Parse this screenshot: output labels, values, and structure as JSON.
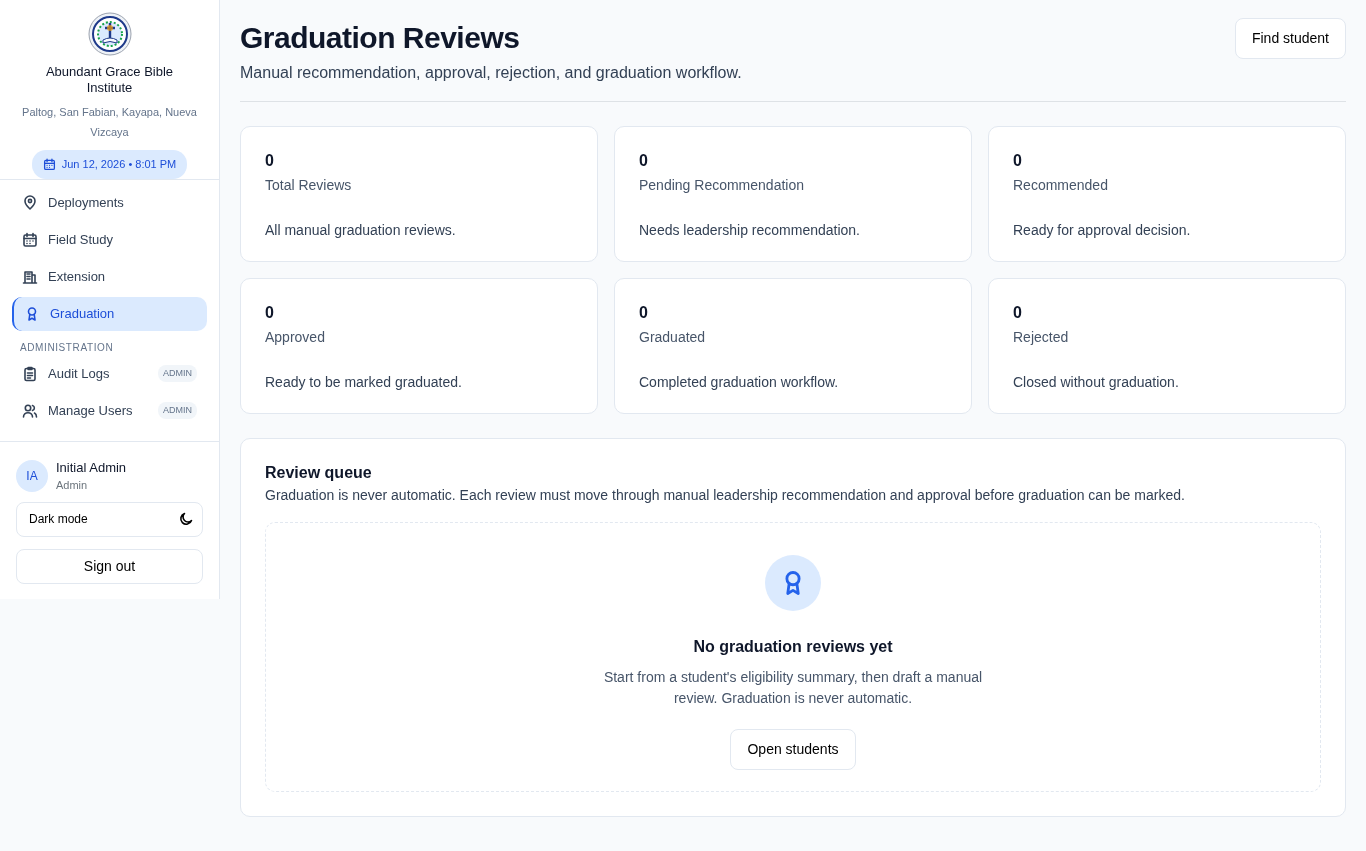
{
  "sidebar": {
    "org_name": "Abundant Grace Bible Institute",
    "org_address": "Paltog, San Fabian, Kayapa, Nueva Vizcaya",
    "datetime": "Jun 12, 2026 • 8:01 PM",
    "nav": [
      {
        "kind": "item",
        "label": "Deployments",
        "selected": false
      },
      {
        "kind": "item",
        "label": "Field Study",
        "selected": false
      },
      {
        "kind": "item",
        "label": "Extension",
        "selected": false
      },
      {
        "kind": "item",
        "label": "Graduation",
        "selected": true
      },
      {
        "kind": "heading",
        "label": "ADMINISTRATION"
      },
      {
        "kind": "item",
        "label": "Audit Logs",
        "badge": "ADMIN",
        "selected": false
      },
      {
        "kind": "item",
        "label": "Manage Users",
        "badge": "ADMIN",
        "selected": false
      }
    ],
    "user": {
      "initials": "IA",
      "name": "Initial Admin",
      "role": "Admin"
    },
    "dark_mode": {
      "label": "Dark mode",
      "on": false
    },
    "sign_out": "Sign out"
  },
  "page": {
    "title": "Graduation Reviews",
    "subtitle": "Manual recommendation, approval, rejection, and graduation workflow.",
    "action": "Find student"
  },
  "stats": [
    {
      "value": "0",
      "label": "Total Reviews",
      "description": "All manual graduation reviews."
    },
    {
      "value": "0",
      "label": "Pending Recommendation",
      "description": "Needs leadership recommendation."
    },
    {
      "value": "0",
      "label": "Recommended",
      "description": "Ready for approval decision."
    },
    {
      "value": "0",
      "label": "Approved",
      "description": "Ready to be marked graduated."
    },
    {
      "value": "0",
      "label": "Graduated",
      "description": "Completed graduation workflow."
    },
    {
      "value": "0",
      "label": "Rejected",
      "description": "Closed without graduation."
    }
  ],
  "queue": {
    "title": "Review queue",
    "description": "Graduation is never automatic. Each review must move through manual leadership recommendation and approval before graduation can be marked.",
    "empty": {
      "title": "No graduation reviews yet",
      "text": "Start from a student's eligibility summary, then draft a manual review. Graduation is never automatic.",
      "button": "Open students"
    }
  }
}
